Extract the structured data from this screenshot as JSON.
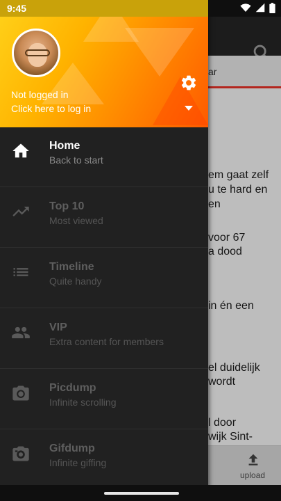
{
  "status_bar": {
    "time": "9:45"
  },
  "background_app": {
    "tab_fragment": "ar",
    "article_fragments": [
      "em gaat zelf",
      "u te hard en",
      "en",
      "voor 67",
      "a dood",
      "in én een",
      "el duidelijk",
      "wordt",
      "l door",
      "wijk Sint-"
    ],
    "upload_label": "upload"
  },
  "drawer": {
    "header": {
      "status": "Not logged in",
      "login_prompt": "Click here to log in"
    },
    "menu": [
      {
        "title": "Home",
        "subtitle": "Back to start",
        "icon": "home-icon",
        "active": true
      },
      {
        "title": "Top 10",
        "subtitle": "Most viewed",
        "icon": "trending-icon",
        "active": false
      },
      {
        "title": "Timeline",
        "subtitle": "Quite handy",
        "icon": "list-icon",
        "active": false
      },
      {
        "title": "VIP",
        "subtitle": "Extra content for members",
        "icon": "people-icon",
        "active": false
      },
      {
        "title": "Picdump",
        "subtitle": "Infinite scrolling",
        "icon": "camera-icon",
        "active": false
      },
      {
        "title": "Gifdump",
        "subtitle": "Infinite giffing",
        "icon": "camera-roll-icon",
        "active": false
      }
    ]
  },
  "colors": {
    "header_gradient_start": "#ffd21a",
    "header_gradient_end": "#ff5a00",
    "tab_underline": "#b3261e",
    "drawer_background": "#212121"
  }
}
